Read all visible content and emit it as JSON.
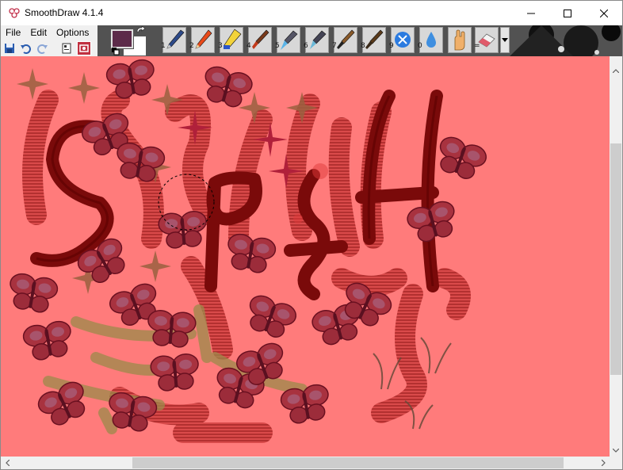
{
  "window": {
    "title": "SmoothDraw 4.1.4"
  },
  "menu": {
    "items": [
      "File",
      "Edit",
      "Options"
    ]
  },
  "colors": {
    "foreground": "#5c2a49",
    "background": "#ffffff",
    "canvas": "#ff7b7b",
    "ink": "#8b0000"
  },
  "tools": [
    {
      "num": "1",
      "icon": "pen-icon"
    },
    {
      "num": "2",
      "icon": "pencil-icon"
    },
    {
      "num": "3",
      "icon": "highlighter-icon"
    },
    {
      "num": "4",
      "icon": "brush-icon"
    },
    {
      "num": "5",
      "icon": "airbrush-icon"
    },
    {
      "num": "6",
      "icon": "spray-icon"
    },
    {
      "num": "7",
      "icon": "paint-brush-icon"
    },
    {
      "num": "8",
      "icon": "oil-brush-icon"
    },
    {
      "num": "9",
      "icon": "image-hose-icon"
    },
    {
      "num": "0",
      "icon": "water-drop-icon"
    },
    {
      "num": "",
      "icon": "hand-icon"
    },
    {
      "num": "=",
      "icon": "eraser-icon"
    }
  ]
}
